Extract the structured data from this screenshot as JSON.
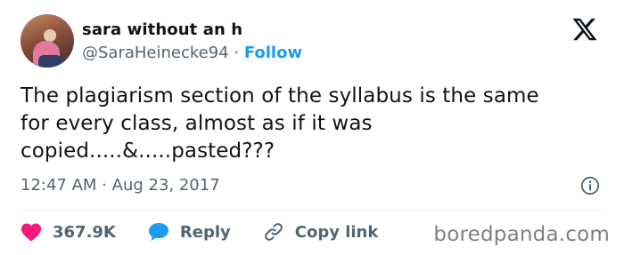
{
  "tweet": {
    "author_name": "sara without an h",
    "handle": "@SaraHeinecke94",
    "separator": " · ",
    "follow_label": "Follow",
    "text": "The plagiarism section of the syllabus is the same\nfor every class, almost as if it was\ncopied.....&.....pasted???",
    "time": "12:47 AM",
    "date_separator": " · ",
    "date": "Aug 23, 2017"
  },
  "actions": {
    "likes": "367.9K",
    "reply_label": "Reply",
    "copy_link_label": "Copy link"
  },
  "icons": {
    "platform": "x-logo-icon",
    "info": "info-icon",
    "like": "heart-icon",
    "reply": "speech-bubble-icon",
    "copy_link": "link-icon"
  },
  "colors": {
    "like": "#f91880",
    "reply": "#1d9bf0",
    "follow": "#1d9bf0",
    "secondary_text": "#536471"
  },
  "watermark": "boredpanda.com"
}
